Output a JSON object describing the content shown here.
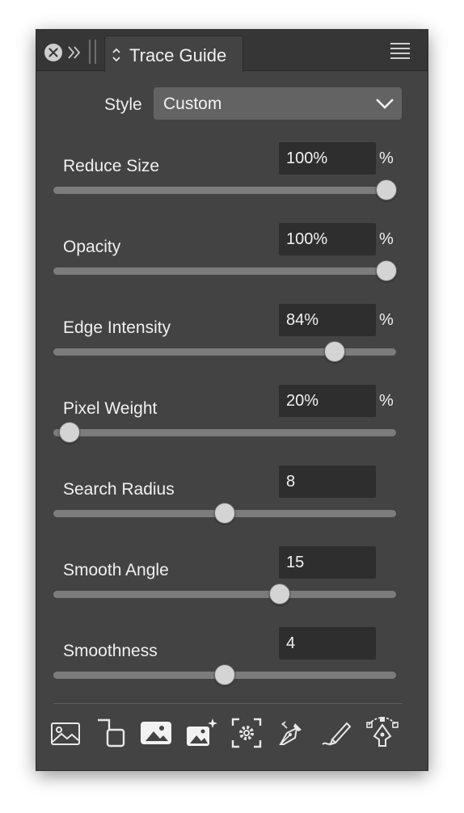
{
  "panel": {
    "title": "Trace Guide"
  },
  "style": {
    "label": "Style",
    "value": "Custom"
  },
  "controls": [
    {
      "label": "Reduce Size",
      "value": "100%",
      "unit": "%",
      "level": 1.0
    },
    {
      "label": "Opacity",
      "value": "100%",
      "unit": "%",
      "level": 1.0
    },
    {
      "label": "Edge Intensity",
      "value": "84%",
      "unit": "%",
      "level": 0.84
    },
    {
      "label": "Pixel Weight",
      "value": "20%",
      "unit": "%",
      "level": 0.02
    },
    {
      "label": "Search Radius",
      "value": "8",
      "unit": "",
      "level": 0.5
    },
    {
      "label": "Smooth Angle",
      "value": "15",
      "unit": "",
      "level": 0.67
    },
    {
      "label": "Smoothness",
      "value": "4",
      "unit": "",
      "level": 0.5
    }
  ],
  "toolbar": {
    "icons": [
      "image-icon",
      "crop-frame-icon",
      "image-filled-icon",
      "image-sparkle-icon",
      "focus-settings-icon",
      "pen-nib-icon",
      "pen-stroke-icon",
      "pen-node-icon"
    ]
  },
  "colors": {
    "panel_bg": "#434343",
    "titlebar_bg": "#363636",
    "field_bg": "#2e2e2e",
    "track": "#7c7c7c",
    "thumb": "#d4d4d4",
    "text": "#f0f0f0"
  }
}
